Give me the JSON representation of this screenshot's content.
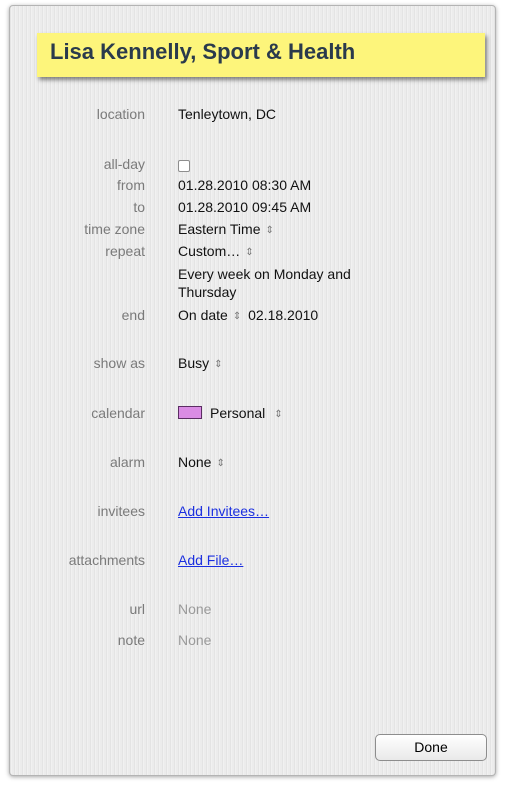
{
  "event": {
    "title": "Lisa Kennelly, Sport & Health"
  },
  "fields": {
    "location": {
      "label": "location",
      "value": "Tenleytown, DC"
    },
    "all_day": {
      "label": "all-day",
      "checked": false
    },
    "from": {
      "label": "from",
      "value": "01.28.2010 08:30 AM"
    },
    "to": {
      "label": "to",
      "value": "01.28.2010 09:45 AM"
    },
    "time_zone": {
      "label": "time zone",
      "value": "Eastern Time"
    },
    "repeat": {
      "label": "repeat",
      "value": "Custom…",
      "description_line1": "Every week on Monday and",
      "description_line2": "Thursday"
    },
    "end": {
      "label": "end",
      "mode": "On date",
      "date": "02.18.2010"
    },
    "show_as": {
      "label": "show as",
      "value": "Busy"
    },
    "calendar": {
      "label": "calendar",
      "value": "Personal",
      "color": "#da8ce4"
    },
    "alarm": {
      "label": "alarm",
      "value": "None"
    },
    "invitees": {
      "label": "invitees",
      "link": "Add Invitees…"
    },
    "attachments": {
      "label": "attachments",
      "link": "Add File…"
    },
    "url": {
      "label": "url",
      "value": "None"
    },
    "note": {
      "label": "note",
      "value": "None"
    }
  },
  "buttons": {
    "done": "Done"
  },
  "icons": {
    "stepper": "updown-arrows-icon"
  },
  "colors": {
    "title_highlight": "#fdf57b",
    "title_text": "#2a3a4c",
    "link": "#1b2fe0",
    "label": "#7a7a7a"
  }
}
